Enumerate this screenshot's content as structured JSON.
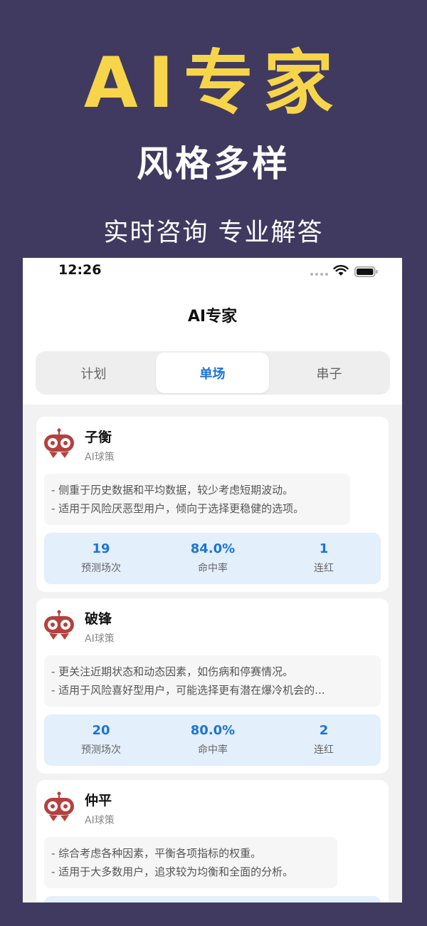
{
  "promo": {
    "title": "AI专家",
    "subtitle": "风格多样",
    "tagline": "实时咨询 专业解答"
  },
  "status_bar": {
    "time": "12:26"
  },
  "nav": {
    "title": "AI专家"
  },
  "tabs": [
    {
      "label": "计划",
      "active": false
    },
    {
      "label": "单场",
      "active": true
    },
    {
      "label": "串子",
      "active": false
    }
  ],
  "experts": [
    {
      "name": "子衡",
      "subtitle": "AI球策",
      "desc": [
        "- 侧重于历史数据和平均数据，较少考虑短期波动。",
        "- 适用于风险厌恶型用户，倾向于选择更稳健的选项。"
      ],
      "stats": [
        {
          "value": "19",
          "label": "预测场次"
        },
        {
          "value": "84.0%",
          "label": "命中率"
        },
        {
          "value": "1",
          "label": "连红"
        }
      ]
    },
    {
      "name": "破锋",
      "subtitle": "AI球策",
      "desc": [
        "- 更关注近期状态和动态因素，如伤病和停赛情况。",
        "- 适用于风险喜好型用户，可能选择更有潜在爆冷机会的..."
      ],
      "stats": [
        {
          "value": "20",
          "label": "预测场次"
        },
        {
          "value": "80.0%",
          "label": "命中率"
        },
        {
          "value": "2",
          "label": "连红"
        }
      ]
    },
    {
      "name": "仲平",
      "subtitle": "AI球策",
      "desc": [
        "- 综合考虑各种因素，平衡各项指标的权重。",
        "- 适用于大多数用户，追求较为均衡和全面的分析。"
      ],
      "stats": []
    }
  ],
  "colors": {
    "background": "#403a60",
    "promo_title": "#f7d54a",
    "accent": "#1d74d4",
    "stats_bg": "#e3effb",
    "avatar": "#b5413e"
  },
  "icons": [
    "robot-football-avatar-icon",
    "wifi-icon",
    "battery-icon",
    "signal-dots-icon"
  ]
}
